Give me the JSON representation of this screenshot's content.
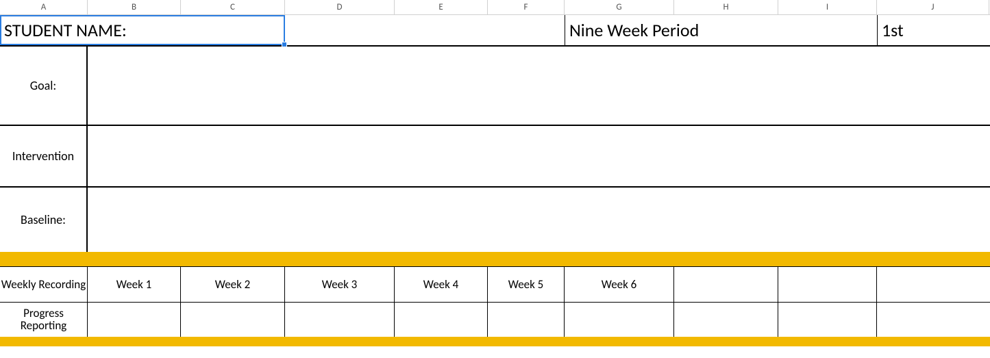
{
  "columns": [
    "A",
    "B",
    "C",
    "D",
    "E",
    "F",
    "G",
    "H",
    "I",
    "J"
  ],
  "row1": {
    "student_name_label": "STUDENT NAME:",
    "nine_week_label": "Nine Week Period",
    "period_value": "1st"
  },
  "labels": {
    "goal": "Goal:",
    "intervention": "Intervention",
    "baseline": "Baseline:",
    "weekly_recording": "Weekly Recording",
    "progress_reporting": "Progress Reporting"
  },
  "weeks": [
    "Week 1",
    "Week 2",
    "Week 3",
    "Week 4",
    "Week 5",
    "Week 6",
    "",
    "",
    ""
  ]
}
